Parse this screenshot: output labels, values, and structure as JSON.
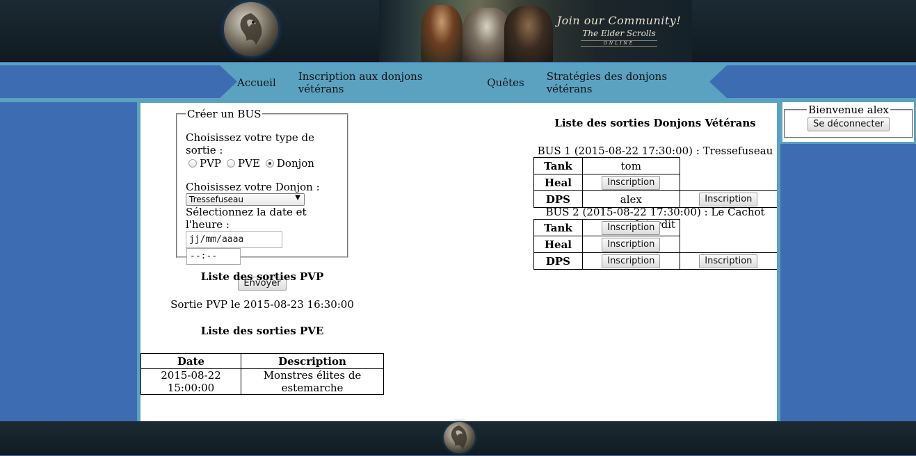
{
  "banner": {
    "line1": "Join our Community!",
    "line2": "The Elder Scrolls",
    "line3": "ONLINE"
  },
  "nav": {
    "items": [
      "Accueil",
      "Inscription aux donjons vétérans",
      "Quêtes",
      "Stratégies des donjons vétérans"
    ]
  },
  "bus_form": {
    "legend": "Créer un BUS",
    "type_label": "Choisissez votre type de sortie :",
    "type_options": [
      "PVP",
      "PVE",
      "Donjon"
    ],
    "type_selected": "Donjon",
    "dungeon_label": "Choisissez votre Donjon :",
    "dungeon_selected": "Tressefuseau",
    "datetime_label": "Sélectionnez la date et l'heure :",
    "date_placeholder": "jj/mm/aaaa",
    "time_placeholder": "--:--",
    "submit_label": "Envoyer"
  },
  "pvp": {
    "title": "Liste des sorties PVP",
    "entry": "Sortie PVP le 2015-08-23 16:30:00"
  },
  "pve": {
    "title": "Liste des sorties PVE",
    "columns": [
      "Date",
      "Description"
    ],
    "rows": [
      [
        "2015-08-22 15:00:00",
        "Monstres élites de estemarche"
      ]
    ]
  },
  "dungeons": {
    "title": "Liste des sorties Donjons Vétérans",
    "buses": [
      {
        "heading": "BUS 1 (2015-08-22 17:30:00) : Tressefuseau",
        "tank": "tom",
        "heal_button": "Inscription",
        "dps": "alex",
        "dps_extra_button": "Inscription"
      },
      {
        "heading": "BUS 2 (2015-08-22 17:30:00) : Le Cachot Interdit",
        "tank_button": "Inscription",
        "heal_button": "Inscription",
        "dps_button": "Inscription",
        "dps_extra_button": "Inscription"
      }
    ],
    "roles": [
      "Tank",
      "Heal",
      "DPS"
    ]
  },
  "user": {
    "welcome": "Bienvenue alex",
    "logout_label": "Se déconnecter"
  },
  "colors": {
    "page_bg": "#3d6cb3",
    "accent": "#5aa2c0",
    "header_bg": "#152129"
  }
}
